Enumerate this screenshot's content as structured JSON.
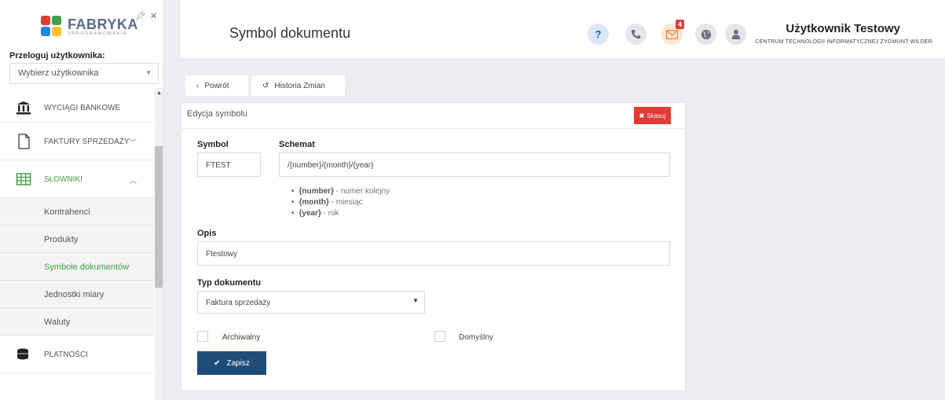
{
  "sidebar": {
    "logo": {
      "word": "FABRYKA",
      "sub": "OPROGRAMOWANIA"
    },
    "switch_user_label": "Przeloguj użytkownika:",
    "select_user_value": "Wybierz użytkownika",
    "menu": [
      {
        "label": "WYCIĄGI BANKOWE",
        "icon": "bank-icon"
      },
      {
        "label": "FAKTURY SPRZEDAŻY",
        "icon": "document-icon"
      },
      {
        "label": "SŁOWNIKI",
        "icon": "table-icon"
      },
      {
        "label": "PŁATNOŚCI",
        "icon": "coins-icon"
      }
    ],
    "submenu": [
      "Kontrahenci",
      "Produkty",
      "Symbole dokumentów",
      "Jednostki miary",
      "Waluty"
    ]
  },
  "header": {
    "title": "Symbol dokumentu",
    "mail_badge": "4",
    "help_glyph": "?",
    "user_name": "Użytkownik Testowy",
    "user_org": "CENTRUM TECHNOLOGII INFORMATYCZNEJ ZYGMUNT WILDER"
  },
  "tabs": {
    "back": "Powrót",
    "history": "Historia Zmian"
  },
  "form": {
    "card_title": "Edycja symbolu",
    "delete_label": "Skasuj",
    "symbol_label": "Symbol",
    "symbol_value": "FTEST",
    "schema_label": "Schemat",
    "schema_value": "/{number}/{month}/{year}",
    "hints": [
      {
        "key": "{number}",
        "desc": " - numer kolejny"
      },
      {
        "key": "{month}",
        "desc": " - miesiąc"
      },
      {
        "key": "{year}",
        "desc": " - rok"
      }
    ],
    "opis_label": "Opis",
    "opis_value": "Ftestowy",
    "doc_type_label": "Typ dokumentu",
    "doc_type_value": "Faktura sprzedaży",
    "archival_label": "Archiwalny",
    "default_label": "Domyślny",
    "save_label": "Zapisz"
  },
  "colors": {
    "accent_green": "#43a047",
    "save_blue": "#1f4d78",
    "delete_red": "#e53935"
  }
}
